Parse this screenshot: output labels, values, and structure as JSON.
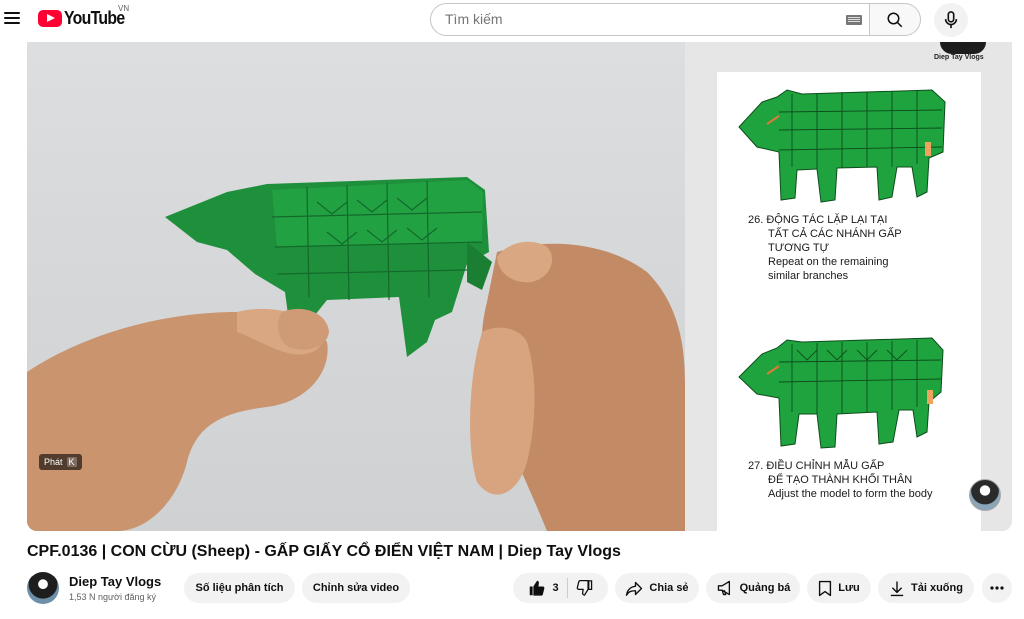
{
  "header": {
    "logo_text": "YouTube",
    "country": "VN",
    "search_placeholder": "Tìm kiếm"
  },
  "player": {
    "play_hint": "Phát",
    "play_key": "K",
    "watermark_channel": "Diep Tay Vlogs",
    "instructions": {
      "step26_vi_line1": "26. ĐỘNG TÁC LẶP LẠI TẠI",
      "step26_vi_line2": "TẤT CẢ CÁC NHÁNH GẤP",
      "step26_vi_line3": "TƯƠNG TỰ",
      "step26_en_line1": "Repeat on the remaining",
      "step26_en_line2": "similar branches",
      "step27_vi_line1": "27. ĐIỀU CHỈNH MẪU GẤP",
      "step27_vi_line2": "ĐỂ TẠO THÀNH KHỐI THÂN",
      "step27_en_line1": "Adjust the model to form the body"
    }
  },
  "video": {
    "title": "CPF.0136 | CON CỪU (Sheep) - GẤP GIẤY CỔ ĐIỂN VIỆT NAM | Diep Tay Vlogs",
    "channel_name": "Diep Tay Vlogs",
    "subscribers": "1,53 N người đăng ký"
  },
  "actions": {
    "analytics": "Số liệu phân tích",
    "edit_video": "Chỉnh sửa video",
    "likes": "3",
    "share": "Chia sẻ",
    "promote": "Quảng bá",
    "save": "Lưu",
    "download": "Tải xuống"
  },
  "colors": {
    "brand_red": "#ff0033",
    "origami_green": "#1e9a3c",
    "pill_bg": "#f2f2f2"
  }
}
